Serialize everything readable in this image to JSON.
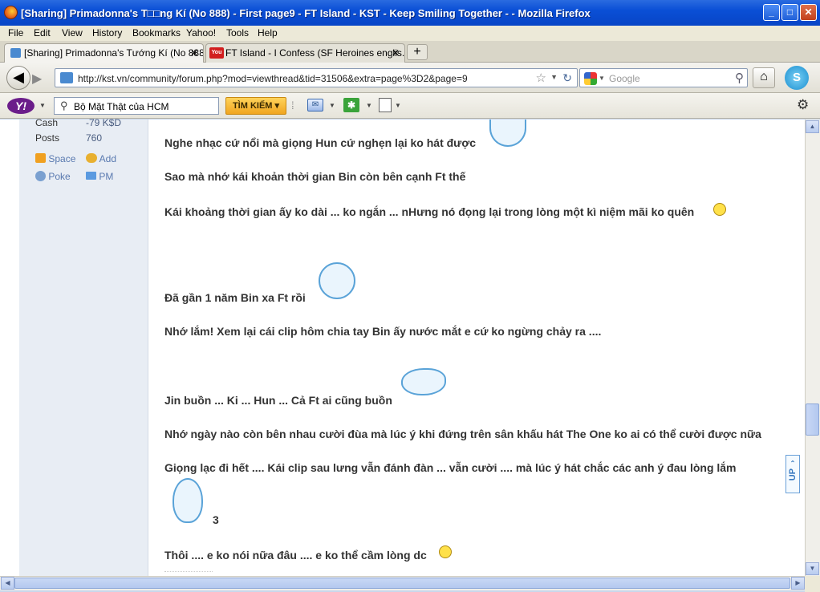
{
  "window": {
    "title": "[Sharing] Primadonna's T□□ng Kí (No 888) - First page9 - FT Island - KST - Keep Smiling Together - - Mozilla Firefox"
  },
  "menu": [
    "File",
    "Edit",
    "View",
    "History",
    "Bookmarks",
    "Yahoo!",
    "Tools",
    "Help"
  ],
  "tabs": [
    {
      "label": "[Sharing] Primadonna's Tướng Kí (No 888...",
      "active": true
    },
    {
      "label": "FT Island - I Confess (SF Heroines englis...",
      "active": false
    }
  ],
  "nav": {
    "url": "http://kst.vn/community/forum.php?mod=viewthread&tid=31506&extra=page%3D2&page=9",
    "search_placeholder": "Google"
  },
  "yahoo": {
    "logo": "Y!",
    "search_value": "Bộ Mặt Thật của HCM",
    "search_button": "TÌM KIẾM"
  },
  "profile": {
    "cash_label": "Cash",
    "cash_value": "-79 K$D",
    "posts_label": "Posts",
    "posts_value": "760",
    "links": [
      "Space",
      "Add",
      "Poke",
      "PM"
    ]
  },
  "post_lines": [
    "Nghe nhạc cứ nổi mà giọng Hun cứ nghẹn lại ko hát được",
    "Sao mà nhớ kái khoản thời gian Bin còn bên cạnh Ft thế",
    "Kái khoảng thời gian ấy ko dài ... ko ngắn ... nHưng nó đọng lại trong lòng một kì niệm mãi ko quên",
    "Đã gần 1 năm Bin xa Ft rồi",
    "Nhớ lắm! Xem lại cái clip hôm chia tay Bin ấy nước mắt e cứ ko ngừng chảy ra ....",
    "Jin buồn ... Ki ... Hun ... Cả Ft ai cũng buồn",
    "Nhớ ngày nào còn bên nhau cười đùa mà lúc ý khi đứng trên sân khấu hát The One ko ai có thể cười được nữa",
    "Giọng lạc đi hết .... Kái clip sau lưng vẫn đánh đàn ... vẫn cười .... mà lúc ý hát chắc các anh ý đau lòng lắm",
    "3",
    "Thôi .... e ko nói nữa đâu .... e ko thể cầm lòng dc"
  ],
  "up_button": "UP"
}
